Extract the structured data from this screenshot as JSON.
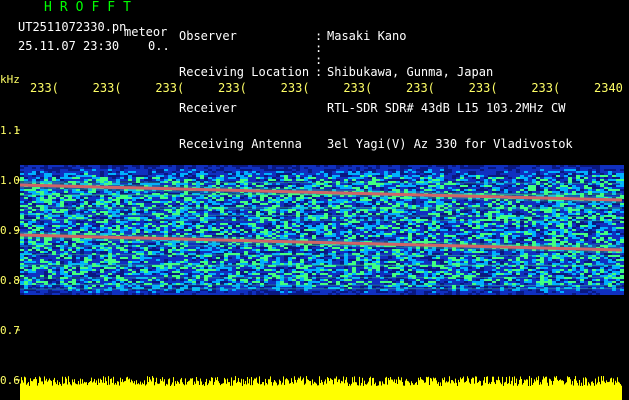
{
  "header": {
    "app_title": "HROFFT",
    "file_name": "UT2511072330.pn",
    "file_suffix": "meteor",
    "timestamp": "25.11.07 23:30    0.."
  },
  "station": {
    "labels": [
      "Observer",
      "Receiving Location",
      "Receiver",
      "Receiving Antenna"
    ],
    "values": [
      "Masaki Kano",
      "Shibukawa, Gunma, Japan",
      "RTL-SDR SDR# 43dB L15 103.2MHz CW",
      "3el Yagi(V) Az 330 for Vladivostok"
    ]
  },
  "chart_data": {
    "type": "heatmap",
    "ylabel": "kHz",
    "y_ticks": [
      "1.1",
      "1.0",
      "0.9",
      "0.8",
      "0.7",
      "0.6"
    ],
    "ylim": [
      0.6,
      1.2
    ],
    "x_ticks": [
      "233(",
      "233(",
      "233(",
      "233(",
      "233(",
      "233(",
      "233(",
      "233(",
      "233(",
      "2340"
    ],
    "signal_band": [
      0.77,
      1.03
    ],
    "carrier_lines": [
      {
        "start_khz": 0.99,
        "end_khz": 0.96
      },
      {
        "start_khz": 0.89,
        "end_khz": 0.86
      }
    ],
    "colors": {
      "background": "#000000",
      "noise_low": "#1030c0",
      "noise_mid": "#00b0ff",
      "noise_high": "#40ff80",
      "carrier": "#ff3060",
      "baseline": "#ffff00",
      "axis_text": "#ffff66"
    }
  }
}
